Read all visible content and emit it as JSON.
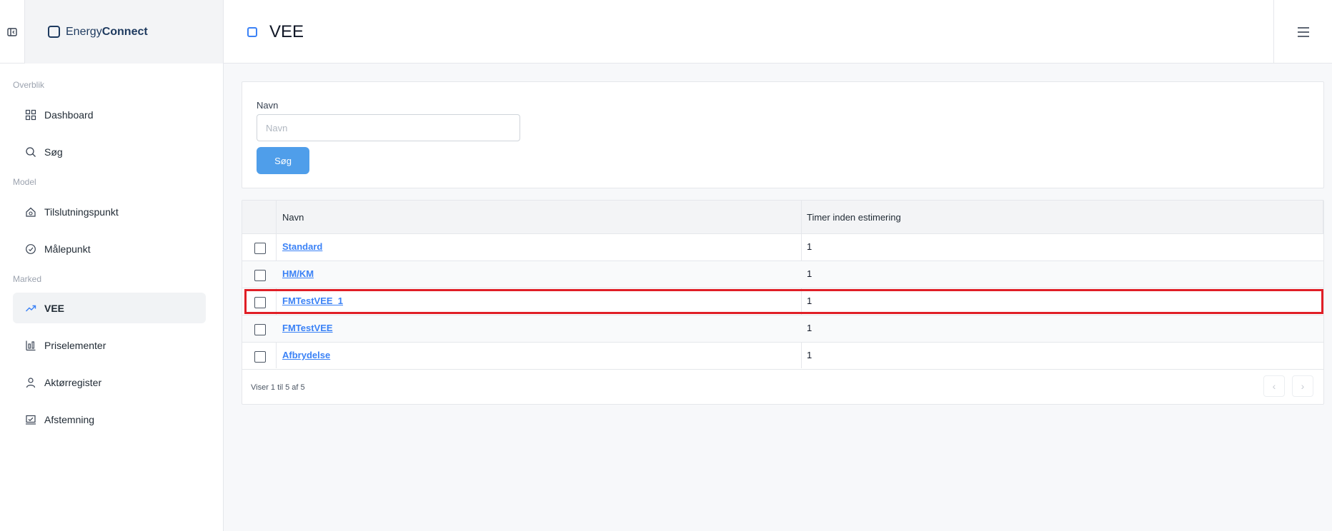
{
  "brand": {
    "name_light": "Energy",
    "name_bold": "Connect"
  },
  "page": {
    "title": "VEE"
  },
  "sidebar": {
    "sections": [
      {
        "label": "Overblik"
      },
      {
        "label": "Model"
      },
      {
        "label": "Marked"
      }
    ],
    "items": [
      {
        "label": "Dashboard",
        "icon": "grid-icon"
      },
      {
        "label": "Søg",
        "icon": "search-icon"
      },
      {
        "label": "Tilslutningspunkt",
        "icon": "house-gear-icon"
      },
      {
        "label": "Målepunkt",
        "icon": "gauge-icon"
      },
      {
        "label": "VEE",
        "icon": "trend-icon",
        "active": true
      },
      {
        "label": "Priselementer",
        "icon": "price-chart-icon"
      },
      {
        "label": "Aktørregister",
        "icon": "user-icon"
      },
      {
        "label": "Afstemning",
        "icon": "reconcile-icon"
      }
    ]
  },
  "search": {
    "label": "Navn",
    "placeholder": "Navn",
    "value": "",
    "button": "Søg"
  },
  "table": {
    "columns": [
      "Navn",
      "Timer inden estimering"
    ],
    "rows": [
      {
        "name": "Standard",
        "hours": "1"
      },
      {
        "name": "HM/KM",
        "hours": "1"
      },
      {
        "name": "FMTestVEE_1",
        "hours": "1",
        "highlighted": true
      },
      {
        "name": "FMTestVEE",
        "hours": "1"
      },
      {
        "name": "Afbrydelse",
        "hours": "1"
      }
    ],
    "footer": "Viser 1 til 5 af 5"
  },
  "colors": {
    "accent": "#4f9eea",
    "highlight": "#e01e26",
    "brand": "#1e3a5f"
  }
}
